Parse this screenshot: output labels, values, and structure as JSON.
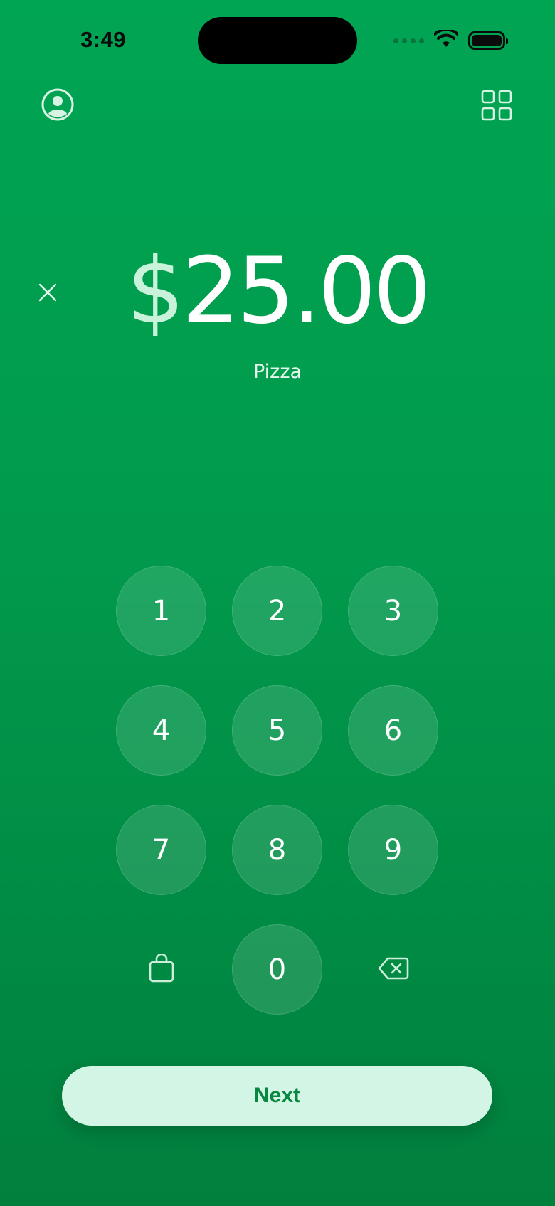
{
  "status_bar": {
    "time": "3:49",
    "wifi_icon": "wifi-icon",
    "battery_icon": "battery-icon"
  },
  "header": {
    "profile_icon": "profile-icon",
    "grid_icon": "grid-icon"
  },
  "payment": {
    "currency": "$",
    "amount": "25.00",
    "note": "Pizza",
    "clear_icon": "close-icon"
  },
  "keypad": {
    "keys": [
      "1",
      "2",
      "3",
      "4",
      "5",
      "6",
      "7",
      "8",
      "9",
      "0"
    ],
    "bag_icon": "shopping-bag-icon",
    "backspace_icon": "backspace-icon"
  },
  "actions": {
    "next_label": "Next"
  },
  "colors": {
    "background": "#00a552",
    "button_bg": "#d2f5e6",
    "button_text": "#078740"
  }
}
